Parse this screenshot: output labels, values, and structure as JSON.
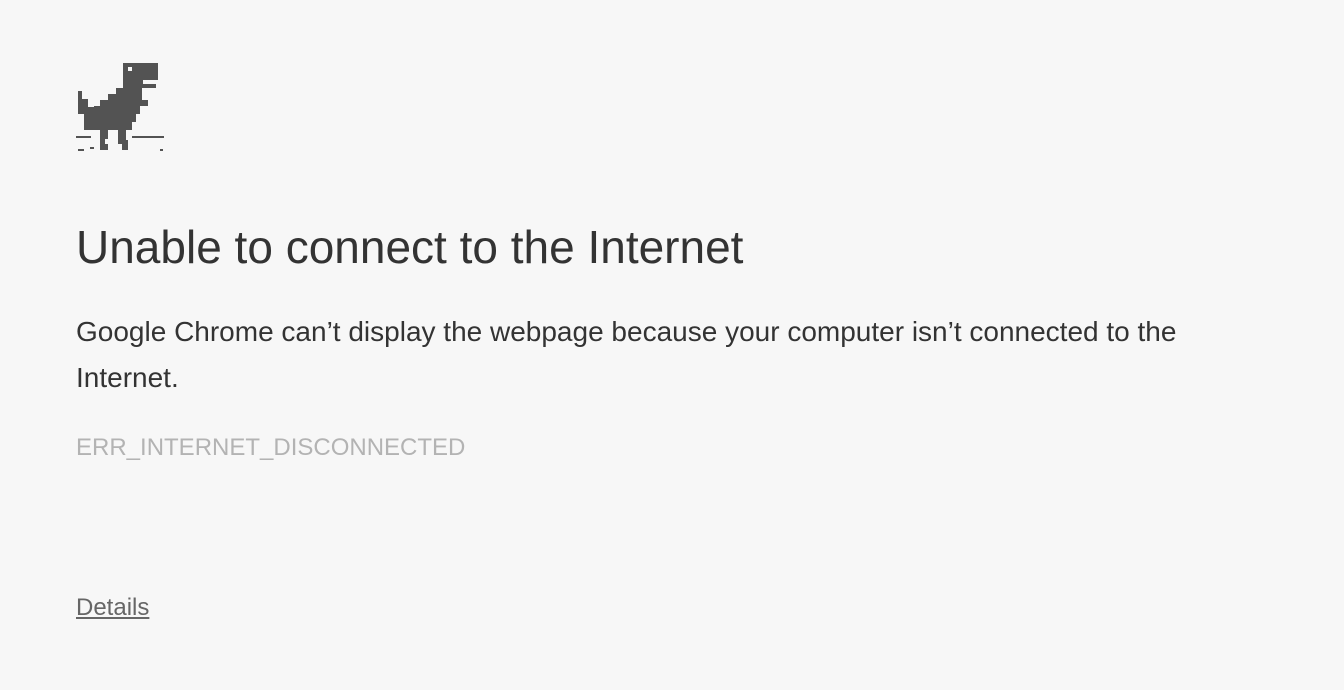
{
  "error_page": {
    "title": "Unable to connect to the Internet",
    "description": "Google Chrome can’t display the webpage because your computer isn’t connected to the Internet.",
    "error_code": "ERR_INTERNET_DISCONNECTED",
    "details_label": "Details"
  },
  "icons": {
    "offline_icon": "t-rex-dinosaur-icon"
  },
  "colors": {
    "background": "#f7f7f7",
    "text": "#333333",
    "error_code": "#b3b3b3",
    "details_link": "#666666",
    "dino": "#535353"
  }
}
